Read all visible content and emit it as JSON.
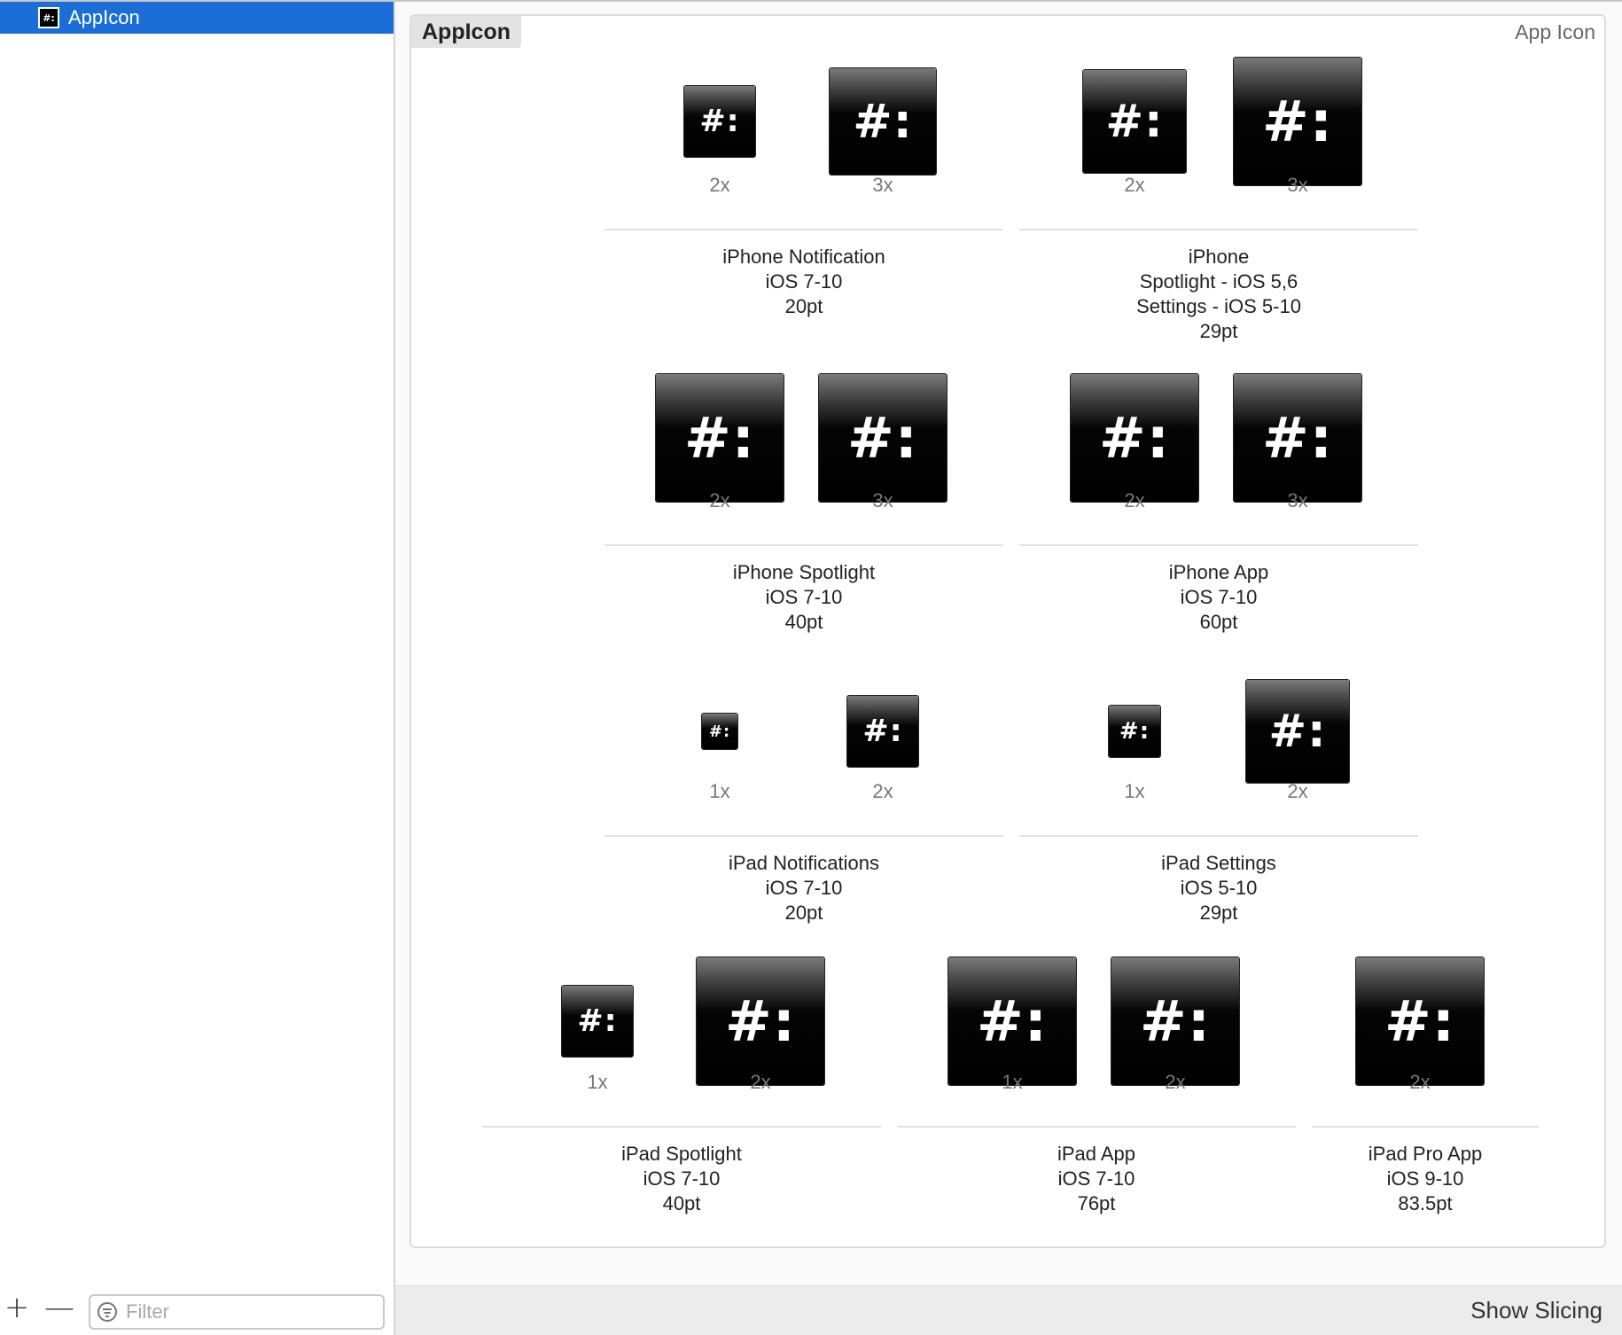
{
  "sidebar": {
    "items": [
      {
        "label": "AppIcon",
        "icon": "app-icon-thumbnail",
        "thumb_glyph": "#:",
        "selected": true
      }
    ],
    "add_label": "+",
    "remove_label": "—",
    "filter": {
      "placeholder": "Filter",
      "value": ""
    }
  },
  "panel": {
    "title": "AppIcon",
    "kind": "App Icon",
    "icon_glyph": "#:"
  },
  "groups": [
    {
      "slots": [
        "2x",
        "3x"
      ],
      "lines": [
        "iPhone Notification",
        "iOS 7-10",
        "20pt"
      ]
    },
    {
      "slots": [
        "2x",
        "3x"
      ],
      "lines": [
        "iPhone",
        "Spotlight - iOS 5,6",
        "Settings - iOS 5-10",
        "29pt"
      ]
    },
    {
      "slots": [
        "2x",
        "3x"
      ],
      "lines": [
        "iPhone Spotlight",
        "iOS 7-10",
        "40pt"
      ]
    },
    {
      "slots": [
        "2x",
        "3x"
      ],
      "lines": [
        "iPhone App",
        "iOS 7-10",
        "60pt"
      ]
    },
    {
      "slots": [
        "1x",
        "2x"
      ],
      "lines": [
        "iPad Notifications",
        "iOS 7-10",
        "20pt"
      ]
    },
    {
      "slots": [
        "1x",
        "2x"
      ],
      "lines": [
        "iPad Settings",
        "iOS 5-10",
        "29pt"
      ]
    },
    {
      "slots": [
        "1x",
        "2x"
      ],
      "lines": [
        "iPad Spotlight",
        "iOS 7-10",
        "40pt"
      ]
    },
    {
      "slots": [
        "1x",
        "2x"
      ],
      "lines": [
        "iPad App",
        "iOS 7-10",
        "76pt"
      ]
    },
    {
      "slots": [
        "2x"
      ],
      "lines": [
        "iPad Pro App",
        "iOS 9-10",
        "83.5pt"
      ]
    }
  ],
  "bottom_bar": {
    "show_slicing_label": "Show Slicing"
  },
  "colors": {
    "selection": "#1b6ed8",
    "icon_background": "#000000",
    "icon_glyph": "#ffffff"
  }
}
